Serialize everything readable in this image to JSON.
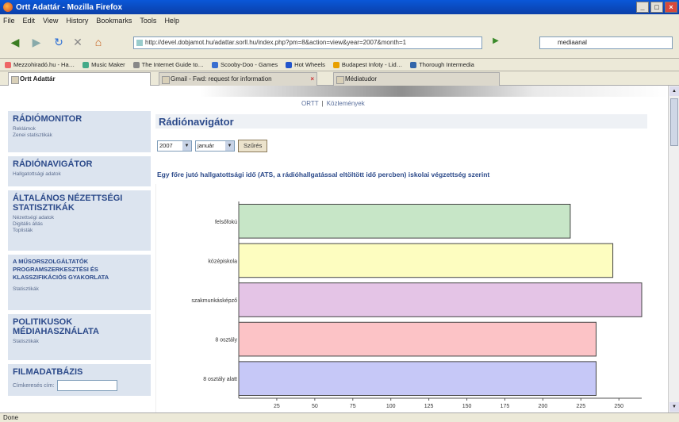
{
  "window": {
    "title": "Ortt Adattár - Mozilla Firefox",
    "controls": [
      "_",
      "□",
      "×"
    ]
  },
  "menu": [
    "File",
    "Edit",
    "View",
    "History",
    "Bookmarks",
    "Tools",
    "Help"
  ],
  "nav": {
    "url": "http://devel.dobjamot.hu/adattar.sorll.hu/index.php?pm=8&action=view&year=2007&month=1",
    "search_value": "mediaanal"
  },
  "bookmarks": [
    "Mezzohiradó.hu - Ha…",
    "Music Maker",
    "The Internet Guide to…",
    "Scooby-Doo - Games",
    "Hot Wheels",
    "Budapest Infoty - Lid…",
    "Thorough Intermedia"
  ],
  "tabs": [
    {
      "label": "Ortt Adattár",
      "active": true
    },
    {
      "label": "Gmail - Fwd: request for information",
      "active": false
    },
    {
      "label": "Médiatudor",
      "active": false
    }
  ],
  "page": {
    "toplinks": {
      "a": "ORTT",
      "sep": "|",
      "b": "Közlemények"
    },
    "sidebar": {
      "radiomonitor": {
        "title": "RÁDIÓMONITOR",
        "links": [
          "Reklámok",
          "Zenei statisztikák"
        ]
      },
      "radionavigator": {
        "title": "RÁDIÓNAVIGÁTOR",
        "links": [
          "Hallgatottsági adatok"
        ]
      },
      "nezettseg": {
        "title": "ÁLTALÁNOS NÉZETTSÉGI STATISZTIKÁK",
        "links": [
          "Nézettségi adatok",
          "Digitális állás",
          "Toplisták"
        ]
      },
      "musorszolgaltatok": {
        "title": "A MŰSORSZOLGÁLTATÓK PROGRAMSZERKESZTÉSI ÉS KLASSZIFIKÁCIÓS GYAKORLATA",
        "links": [
          "Statisztikák"
        ]
      },
      "politikusok": {
        "title": "POLITIKUSOK MÉDIAHASZNÁLATA",
        "links": [
          "Statisztikák"
        ]
      },
      "filmadatbazis": {
        "title": "FILMADATBÁZIS",
        "search_label": "Címkeresés cím:",
        "search_value": ""
      }
    },
    "main": {
      "heading": "Rádiónavigátor",
      "year": "2007",
      "month": "január",
      "submit": "Szűrés",
      "chart_title": "Egy főre jutó hallgatottsági idő (ATS, a rádióhallgatással eltöltött idő percben) iskolai végzettség szerint"
    }
  },
  "status": "Done",
  "chart_data": {
    "type": "bar",
    "orientation": "horizontal",
    "categories": [
      "felsőfokú",
      "középiskola",
      "szakmunkásképző",
      "8 osztály",
      "8 osztály alatt"
    ],
    "values": [
      218,
      246,
      265,
      235,
      235
    ],
    "colors": [
      "#c7e6c7",
      "#fdfdc0",
      "#e4c4e6",
      "#fcc3c6",
      "#c6c8f7"
    ],
    "xticks": [
      25,
      50,
      75,
      100,
      125,
      150,
      175,
      200,
      225,
      250
    ],
    "xlim": [
      0,
      265
    ],
    "title": "",
    "xlabel": "",
    "ylabel": "",
    "grid": false
  }
}
